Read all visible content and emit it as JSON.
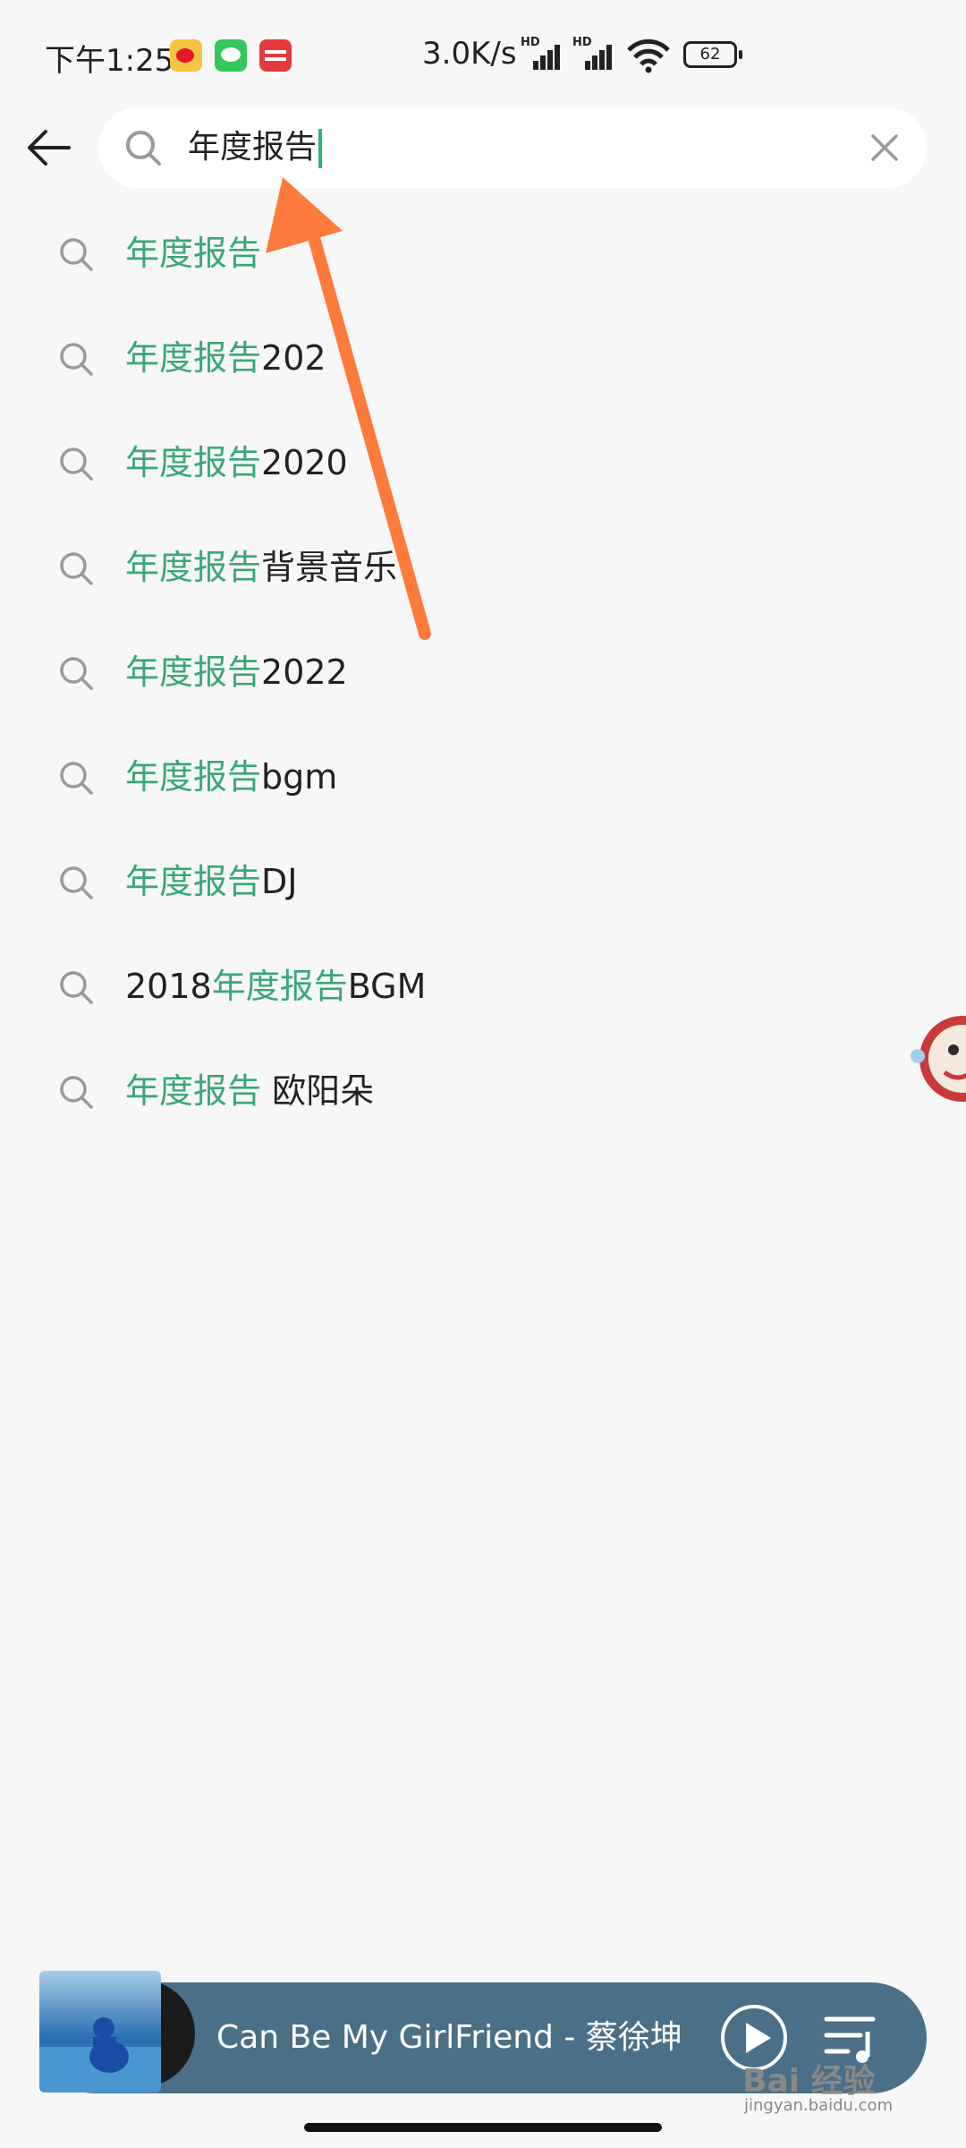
{
  "status_bar": {
    "time": "下午1:25",
    "net_speed": "3.0K/s",
    "signal_label": "HD",
    "battery": "62",
    "apps": [
      "weibo-icon",
      "message-icon",
      "shopping-app-icon"
    ]
  },
  "search": {
    "query": "年度报告",
    "back_icon": "back-arrow-icon",
    "search_icon": "search-icon",
    "clear_icon": "close-icon"
  },
  "suggestions": [
    {
      "pre": "",
      "hl": "年度报告",
      "post": ""
    },
    {
      "pre": "",
      "hl": "年度报告",
      "post": "202"
    },
    {
      "pre": "",
      "hl": "年度报告",
      "post": "2020"
    },
    {
      "pre": "",
      "hl": "年度报告",
      "post": "背景音乐"
    },
    {
      "pre": "",
      "hl": "年度报告",
      "post": "2022"
    },
    {
      "pre": "",
      "hl": "年度报告",
      "post": "bgm"
    },
    {
      "pre": "",
      "hl": "年度报告",
      "post": "DJ"
    },
    {
      "pre": "2018",
      "hl": "年度报告",
      "post": "BGM"
    },
    {
      "pre": "",
      "hl": "年度报告",
      "post": " 欧阳朵"
    }
  ],
  "colors": {
    "highlight": "#3aa67a",
    "background": "#f7f7f7",
    "player": "#4a6f86",
    "annotation_arrow": "#ff7a3d"
  },
  "player": {
    "title": "Can Be My GirlFriend - 蔡徐坤",
    "play_icon": "play-icon",
    "playlist_icon": "playlist-icon"
  },
  "watermark": {
    "text": "Bai 经验",
    "sub": "jingyan.baidu.com"
  }
}
